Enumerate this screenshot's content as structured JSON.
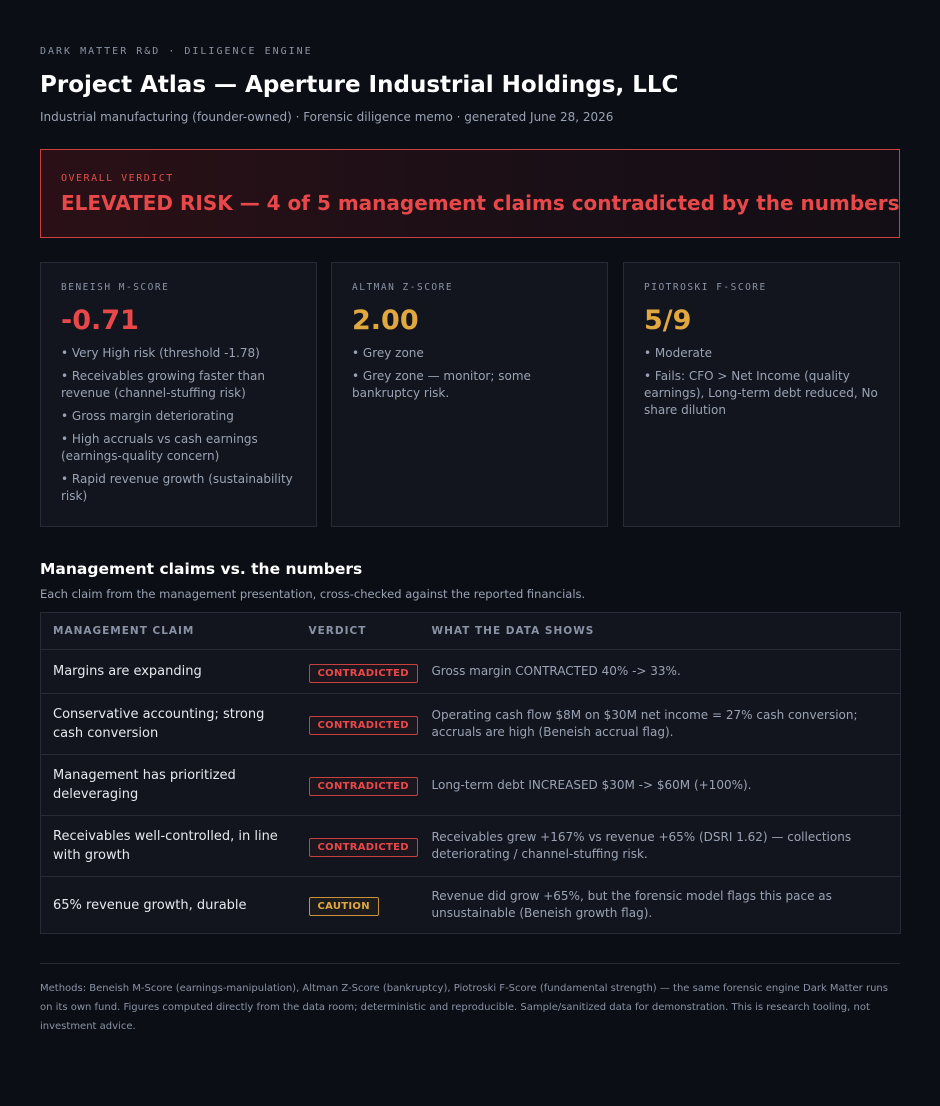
{
  "header": {
    "eyebrow": "DARK MATTER R&D · DILIGENCE ENGINE",
    "title": "Project Atlas — Aperture Industrial Holdings, LLC",
    "subtitle": "Industrial manufacturing (founder-owned) · Forensic diligence memo · generated June 28, 2026"
  },
  "verdict": {
    "label": "OVERALL VERDICT",
    "text": "ELEVATED RISK — 4 of 5 management claims contradicted by the numbers",
    "color": "#e8484a"
  },
  "scores": [
    {
      "label": "BENEISH M-SCORE",
      "value": "-0.71",
      "color": "#e8484a",
      "notes": [
        "• Very High risk (threshold -1.78)",
        "• Receivables growing faster than revenue (channel-stuffing risk)",
        "• Gross margin deteriorating",
        "• High accruals vs cash earnings (earnings-quality concern)",
        "• Rapid revenue growth (sustainability risk)"
      ]
    },
    {
      "label": "ALTMAN Z-SCORE",
      "value": "2.00",
      "color": "#e0a83e",
      "notes": [
        "• Grey zone",
        "• Grey zone — monitor; some bankruptcy risk."
      ]
    },
    {
      "label": "PIOTROSKI F-SCORE",
      "value": "5/9",
      "color": "#e0a83e",
      "notes": [
        "• Moderate",
        "• Fails: CFO > Net Income (quality earnings), Long-term debt reduced, No share dilution"
      ]
    }
  ],
  "claims_section": {
    "title": "Management claims vs. the numbers",
    "subtitle": "Each claim from the management presentation, cross-checked against the reported financials.",
    "columns": [
      "MANAGEMENT CLAIM",
      "VERDICT",
      "WHAT THE DATA SHOWS"
    ],
    "rows": [
      {
        "claim": "Margins are expanding",
        "verdict": "CONTRADICTED",
        "status": "contradicted",
        "data": "Gross margin CONTRACTED 40% -> 33%."
      },
      {
        "claim": "Conservative accounting; strong cash conversion",
        "verdict": "CONTRADICTED",
        "status": "contradicted",
        "data": "Operating cash flow $8M on $30M net income = 27% cash conversion; accruals are high (Beneish accrual flag)."
      },
      {
        "claim": "Management has prioritized deleveraging",
        "verdict": "CONTRADICTED",
        "status": "contradicted",
        "data": "Long-term debt INCREASED $30M -> $60M (+100%)."
      },
      {
        "claim": "Receivables well-controlled, in line with growth",
        "verdict": "CONTRADICTED",
        "status": "contradicted",
        "data": "Receivables grew +167% vs revenue +65% (DSRI 1.62) — collections deteriorating / channel-stuffing risk."
      },
      {
        "claim": "65% revenue growth, durable",
        "verdict": "CAUTION",
        "status": "caution",
        "data": "Revenue did grow +65%, but the forensic model flags this pace as unsustainable (Beneish growth flag)."
      }
    ]
  },
  "footer": {
    "text": "Methods: Beneish M-Score (earnings-manipulation), Altman Z-Score (bankruptcy), Piotroski F-Score (fundamental strength) — the same forensic engine Dark Matter runs on its own fund. Figures computed directly from the data room; deterministic and reproducible. Sample/sanitized data for demonstration. This is research tooling, not investment advice."
  }
}
